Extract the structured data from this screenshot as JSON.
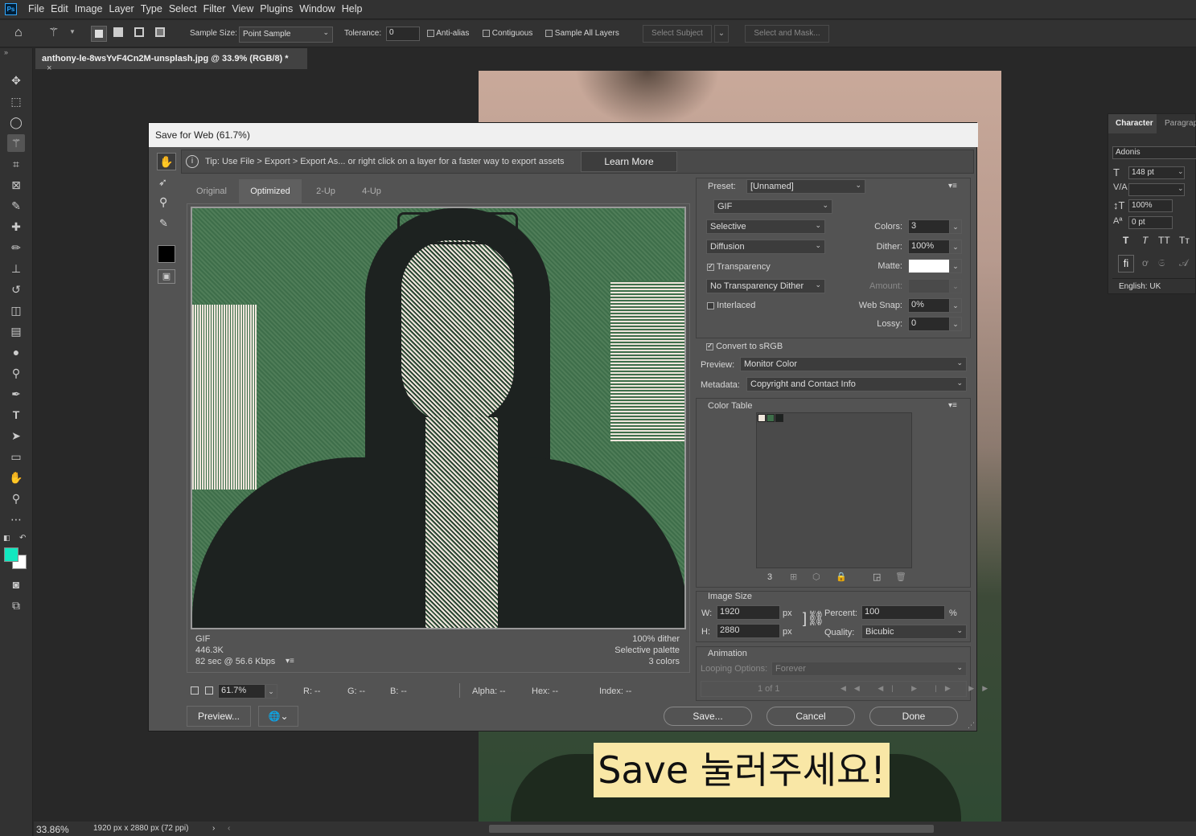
{
  "menubar": {
    "logo": "Ps",
    "items": [
      "File",
      "Edit",
      "Image",
      "Layer",
      "Type",
      "Select",
      "Filter",
      "View",
      "Plugins",
      "Window",
      "Help"
    ]
  },
  "options": {
    "sample_size_label": "Sample Size:",
    "sample_size_value": "Point Sample",
    "tolerance_label": "Tolerance:",
    "tolerance_value": "0",
    "anti_alias": "Anti-alias",
    "contiguous": "Contiguous",
    "sample_all_layers": "Sample All Layers",
    "select_subject": "Select Subject",
    "select_mask": "Select and Mask..."
  },
  "document": {
    "tab_title": "anthony-le-8wsYvF4Cn2M-unsplash.jpg @ 33.9% (RGB/8) *",
    "close": "×"
  },
  "status": {
    "zoom": "33.86%",
    "info": "1920 px x 2880 px (72 ppi)"
  },
  "character": {
    "tab1": "Character",
    "tab2": "Paragrap",
    "font": "Adonis",
    "size": "148 pt",
    "tracking": "",
    "scale": "100%",
    "baseline": "0 pt",
    "lang": "English: UK",
    "styles": [
      "T",
      "T",
      "TT",
      "Tт"
    ]
  },
  "overlay": {
    "text": "Save 눌러주세요!"
  },
  "dialog": {
    "title": "Save for Web (61.7%)",
    "tip": "Tip: Use File > Export > Export As...  or right click on a layer for a faster way to export assets",
    "learn_more": "Learn More",
    "tabs": [
      "Original",
      "Optimized",
      "2-Up",
      "4-Up"
    ],
    "preview_info": {
      "format": "GIF",
      "size": "446.3K",
      "time": "82 sec @ 56.6 Kbps",
      "dither": "100% dither",
      "palette": "Selective palette",
      "colors": "3 colors"
    },
    "bottom": {
      "zoom": "61.7%",
      "r": "R: --",
      "g": "G: --",
      "b": "B: --",
      "alpha": "Alpha: --",
      "hex": "Hex: --",
      "index": "Index: --"
    },
    "buttons": {
      "preview": "Preview...",
      "save": "Save...",
      "cancel": "Cancel",
      "done": "Done"
    },
    "settings": {
      "preset_label": "Preset:",
      "preset_value": "[Unnamed]",
      "format": "GIF",
      "reduction": "Selective",
      "dither_algo": "Diffusion",
      "transparency": "Transparency",
      "trans_dither": "No Transparency Dither",
      "interlaced": "Interlaced",
      "colors_label": "Colors:",
      "colors_value": "3",
      "dither_label": "Dither:",
      "dither_value": "100%",
      "matte_label": "Matte:",
      "amount_label": "Amount:",
      "websnap_label": "Web Snap:",
      "websnap_value": "0%",
      "lossy_label": "Lossy:",
      "lossy_value": "0",
      "convert_srgb": "Convert to sRGB",
      "preview_label": "Preview:",
      "preview_value": "Monitor Color",
      "metadata_label": "Metadata:",
      "metadata_value": "Copyright and Contact Info"
    },
    "color_table": {
      "title": "Color Table",
      "count": "3",
      "swatches": [
        "#efe6dc",
        "#3e6e4a",
        "#1d2220"
      ]
    },
    "image_size": {
      "title": "Image Size",
      "w_label": "W:",
      "w": "1920",
      "h_label": "H:",
      "h": "2880",
      "unit": "px",
      "percent_label": "Percent:",
      "percent": "100",
      "pct": "%",
      "quality_label": "Quality:",
      "quality": "Bicubic"
    },
    "animation": {
      "title": "Animation",
      "looping_label": "Looping Options:",
      "looping": "Forever",
      "frame": "1 of 1"
    }
  }
}
